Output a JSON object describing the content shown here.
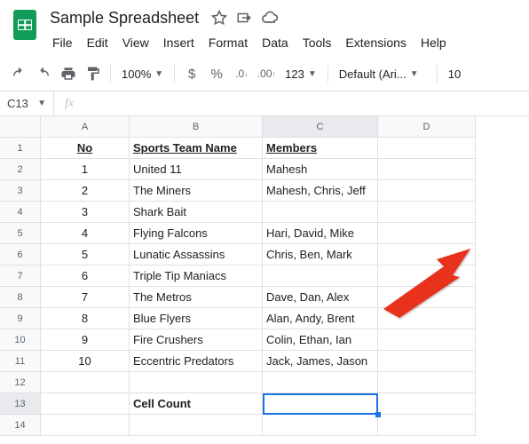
{
  "doc": {
    "title": "Sample Spreadsheet"
  },
  "menu": {
    "file": "File",
    "edit": "Edit",
    "view": "View",
    "insert": "Insert",
    "format": "Format",
    "data": "Data",
    "tools": "Tools",
    "extensions": "Extensions",
    "help": "Help"
  },
  "toolbar": {
    "zoom": "100%",
    "font": "Default (Ari...",
    "fontsize": "10",
    "numfmt": "123"
  },
  "namebox": {
    "ref": "C13"
  },
  "formula": {
    "value": ""
  },
  "columns": {
    "a": "A",
    "b": "B",
    "c": "C",
    "d": "D"
  },
  "rows": {
    "r1": "1",
    "r2": "2",
    "r3": "3",
    "r4": "4",
    "r5": "5",
    "r6": "6",
    "r7": "7",
    "r8": "8",
    "r9": "9",
    "r10": "10",
    "r11": "11",
    "r12": "12",
    "r13": "13",
    "r14": "14"
  },
  "cells": {
    "a1": "No",
    "b1": "Sports Team Name",
    "c1": "Members",
    "a2": "1",
    "b2": "United 11",
    "c2": "Mahesh",
    "a3": "2",
    "b3": "The Miners",
    "c3": "Mahesh, Chris, Jeff",
    "a4": "3",
    "b4": "Shark Bait",
    "c4": "",
    "a5": "4",
    "b5": "Flying Falcons",
    "c5": "Hari, David, Mike",
    "a6": "5",
    "b6": "Lunatic Assassins",
    "c6": "Chris, Ben, Mark",
    "a7": "6",
    "b7": "Triple Tip Maniacs",
    "c7": "",
    "a8": "7",
    "b8": "The Metros",
    "c8": "Dave, Dan, Alex",
    "a9": "8",
    "b9": "Blue Flyers",
    "c9": "Alan, Andy, Brent",
    "a10": "9",
    "b10": "Fire Crushers",
    "c10": "Colin, Ethan, Ian",
    "a11": "10",
    "b11": "Eccentric Predators",
    "c11": "Jack, James, Jason",
    "b13": "Cell Count"
  }
}
